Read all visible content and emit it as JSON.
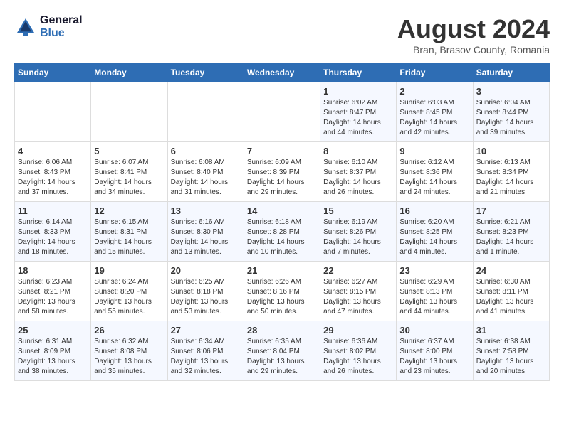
{
  "logo": {
    "general": "General",
    "blue": "Blue"
  },
  "title": "August 2024",
  "location": "Bran, Brasov County, Romania",
  "headers": [
    "Sunday",
    "Monday",
    "Tuesday",
    "Wednesday",
    "Thursday",
    "Friday",
    "Saturday"
  ],
  "weeks": [
    [
      {
        "day": "",
        "content": ""
      },
      {
        "day": "",
        "content": ""
      },
      {
        "day": "",
        "content": ""
      },
      {
        "day": "",
        "content": ""
      },
      {
        "day": "1",
        "content": "Sunrise: 6:02 AM\nSunset: 8:47 PM\nDaylight: 14 hours and 44 minutes."
      },
      {
        "day": "2",
        "content": "Sunrise: 6:03 AM\nSunset: 8:45 PM\nDaylight: 14 hours and 42 minutes."
      },
      {
        "day": "3",
        "content": "Sunrise: 6:04 AM\nSunset: 8:44 PM\nDaylight: 14 hours and 39 minutes."
      }
    ],
    [
      {
        "day": "4",
        "content": "Sunrise: 6:06 AM\nSunset: 8:43 PM\nDaylight: 14 hours and 37 minutes."
      },
      {
        "day": "5",
        "content": "Sunrise: 6:07 AM\nSunset: 8:41 PM\nDaylight: 14 hours and 34 minutes."
      },
      {
        "day": "6",
        "content": "Sunrise: 6:08 AM\nSunset: 8:40 PM\nDaylight: 14 hours and 31 minutes."
      },
      {
        "day": "7",
        "content": "Sunrise: 6:09 AM\nSunset: 8:39 PM\nDaylight: 14 hours and 29 minutes."
      },
      {
        "day": "8",
        "content": "Sunrise: 6:10 AM\nSunset: 8:37 PM\nDaylight: 14 hours and 26 minutes."
      },
      {
        "day": "9",
        "content": "Sunrise: 6:12 AM\nSunset: 8:36 PM\nDaylight: 14 hours and 24 minutes."
      },
      {
        "day": "10",
        "content": "Sunrise: 6:13 AM\nSunset: 8:34 PM\nDaylight: 14 hours and 21 minutes."
      }
    ],
    [
      {
        "day": "11",
        "content": "Sunrise: 6:14 AM\nSunset: 8:33 PM\nDaylight: 14 hours and 18 minutes."
      },
      {
        "day": "12",
        "content": "Sunrise: 6:15 AM\nSunset: 8:31 PM\nDaylight: 14 hours and 15 minutes."
      },
      {
        "day": "13",
        "content": "Sunrise: 6:16 AM\nSunset: 8:30 PM\nDaylight: 14 hours and 13 minutes."
      },
      {
        "day": "14",
        "content": "Sunrise: 6:18 AM\nSunset: 8:28 PM\nDaylight: 14 hours and 10 minutes."
      },
      {
        "day": "15",
        "content": "Sunrise: 6:19 AM\nSunset: 8:26 PM\nDaylight: 14 hours and 7 minutes."
      },
      {
        "day": "16",
        "content": "Sunrise: 6:20 AM\nSunset: 8:25 PM\nDaylight: 14 hours and 4 minutes."
      },
      {
        "day": "17",
        "content": "Sunrise: 6:21 AM\nSunset: 8:23 PM\nDaylight: 14 hours and 1 minute."
      }
    ],
    [
      {
        "day": "18",
        "content": "Sunrise: 6:23 AM\nSunset: 8:21 PM\nDaylight: 13 hours and 58 minutes."
      },
      {
        "day": "19",
        "content": "Sunrise: 6:24 AM\nSunset: 8:20 PM\nDaylight: 13 hours and 55 minutes."
      },
      {
        "day": "20",
        "content": "Sunrise: 6:25 AM\nSunset: 8:18 PM\nDaylight: 13 hours and 53 minutes."
      },
      {
        "day": "21",
        "content": "Sunrise: 6:26 AM\nSunset: 8:16 PM\nDaylight: 13 hours and 50 minutes."
      },
      {
        "day": "22",
        "content": "Sunrise: 6:27 AM\nSunset: 8:15 PM\nDaylight: 13 hours and 47 minutes."
      },
      {
        "day": "23",
        "content": "Sunrise: 6:29 AM\nSunset: 8:13 PM\nDaylight: 13 hours and 44 minutes."
      },
      {
        "day": "24",
        "content": "Sunrise: 6:30 AM\nSunset: 8:11 PM\nDaylight: 13 hours and 41 minutes."
      }
    ],
    [
      {
        "day": "25",
        "content": "Sunrise: 6:31 AM\nSunset: 8:09 PM\nDaylight: 13 hours and 38 minutes."
      },
      {
        "day": "26",
        "content": "Sunrise: 6:32 AM\nSunset: 8:08 PM\nDaylight: 13 hours and 35 minutes."
      },
      {
        "day": "27",
        "content": "Sunrise: 6:34 AM\nSunset: 8:06 PM\nDaylight: 13 hours and 32 minutes."
      },
      {
        "day": "28",
        "content": "Sunrise: 6:35 AM\nSunset: 8:04 PM\nDaylight: 13 hours and 29 minutes."
      },
      {
        "day": "29",
        "content": "Sunrise: 6:36 AM\nSunset: 8:02 PM\nDaylight: 13 hours and 26 minutes."
      },
      {
        "day": "30",
        "content": "Sunrise: 6:37 AM\nSunset: 8:00 PM\nDaylight: 13 hours and 23 minutes."
      },
      {
        "day": "31",
        "content": "Sunrise: 6:38 AM\nSunset: 7:58 PM\nDaylight: 13 hours and 20 minutes."
      }
    ]
  ]
}
